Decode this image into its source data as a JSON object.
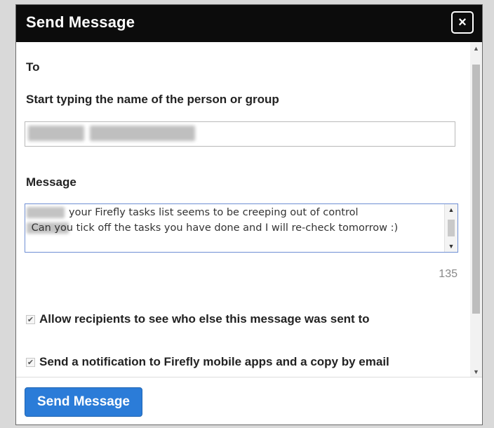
{
  "dialog": {
    "title": "Send Message",
    "close_icon": "close-icon",
    "close_glyph": "×"
  },
  "form": {
    "to_label": "To",
    "to_hint": "Start typing the name of the person or group",
    "message_label": "Message",
    "message_text": "your Firefly tasks list seems to be creeping out of control\n Can you tick off the tasks you have done and I will re-check tomorrow :)",
    "char_count": "135",
    "checkboxes": [
      {
        "label": "Allow recipients to see who else this message was sent to",
        "checked": true
      },
      {
        "label": "Send a notification to Firefly mobile apps and a copy by email",
        "checked": true
      }
    ]
  },
  "footer": {
    "send_label": "Send Message"
  },
  "colors": {
    "titlebar": "#0c0c0c",
    "send_button": "#2b7cd8",
    "message_border": "#6f8fd4"
  }
}
